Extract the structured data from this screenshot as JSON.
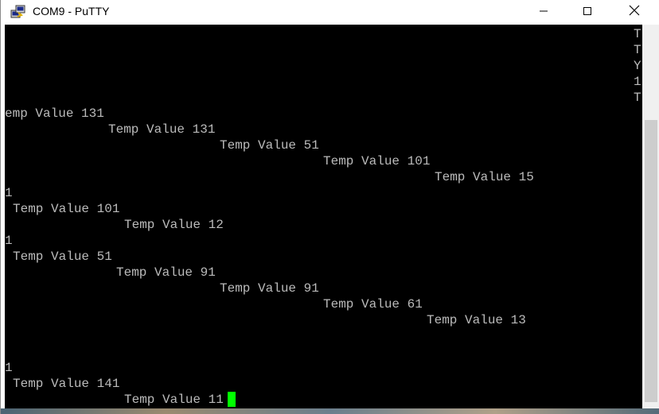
{
  "window": {
    "title": "COM9 - PuTTY",
    "icon": "putty-app-icon",
    "controls": {
      "minimize_icon": "minimize-icon",
      "maximize_icon": "maximize-icon",
      "close_icon": "close-icon"
    }
  },
  "terminal": {
    "foreground": "#bbbbbb",
    "background": "#000000",
    "cursor_color": "#00ff00",
    "right_column": [
      "T",
      "T",
      "Y",
      "1",
      "T"
    ],
    "lines": [
      "emp Value 131",
      "Temp Value 131",
      "Temp Value 51",
      "Temp Value 101",
      "Temp Value 15",
      "1",
      "Temp Value 101",
      "Temp Value 12",
      "1",
      "Temp Value 51",
      "Temp Value 91",
      "Temp Value 91",
      "Temp Value 61",
      "Temp Value 13",
      "1",
      "Temp Value 141",
      "Temp Value 11"
    ]
  }
}
